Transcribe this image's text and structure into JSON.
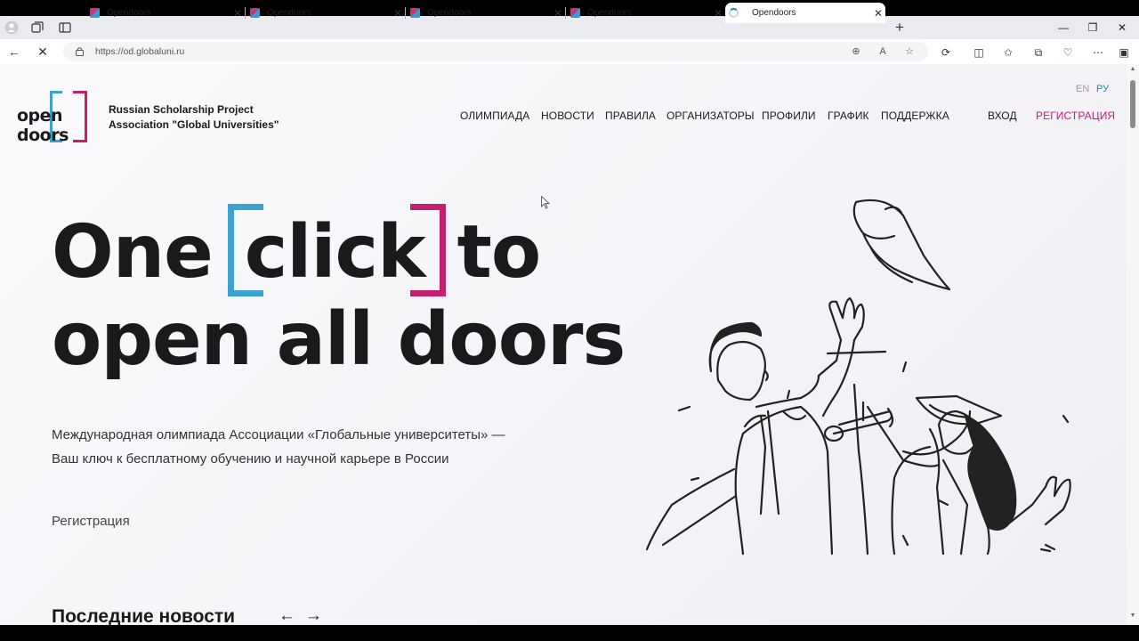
{
  "browser": {
    "tabs": [
      {
        "title": "Opendoors"
      },
      {
        "title": "Opendoors"
      },
      {
        "title": "Opendoors"
      },
      {
        "title": "Opendoors"
      },
      {
        "title": "Opendoors",
        "active": true,
        "loading": true
      }
    ],
    "url": "https://od.globaluni.ru"
  },
  "site": {
    "logo_text": "open doors",
    "org_line1": "Russian Scholarship Project",
    "org_line2": "Association \"Global Universities\"",
    "lang": {
      "en": "EN",
      "ru": "РУ"
    },
    "menu": [
      "ОЛИМПИАДА",
      "НОВОСТИ",
      "ПРАВИЛА",
      "ОРГАНИЗАТОРЫ",
      "ПРОФИЛИ",
      "ГРАФИК",
      "ПОДДЕРЖКА"
    ],
    "login": "ВХОД",
    "register_nav": "РЕГИСТРАЦИЯ",
    "hero_one": "One",
    "hero_click": "click",
    "hero_to": "to",
    "hero_line2": "open all doors",
    "subtitle_line1": "Международная олимпиада Ассоциации «Глобальные университеты» —",
    "subtitle_line2": "Ваш ключ к бесплатному обучению и научной карьере в России",
    "register_link": "Регистрация",
    "news_heading": "Последние новости",
    "arrow_prev": "←",
    "arrow_next": "→"
  },
  "colors": {
    "accent_pink": "#c5206f",
    "accent_blue": "#3aa3cf",
    "lang_ru": "#1b8a9c",
    "lang_en": "#9a9aa2"
  }
}
